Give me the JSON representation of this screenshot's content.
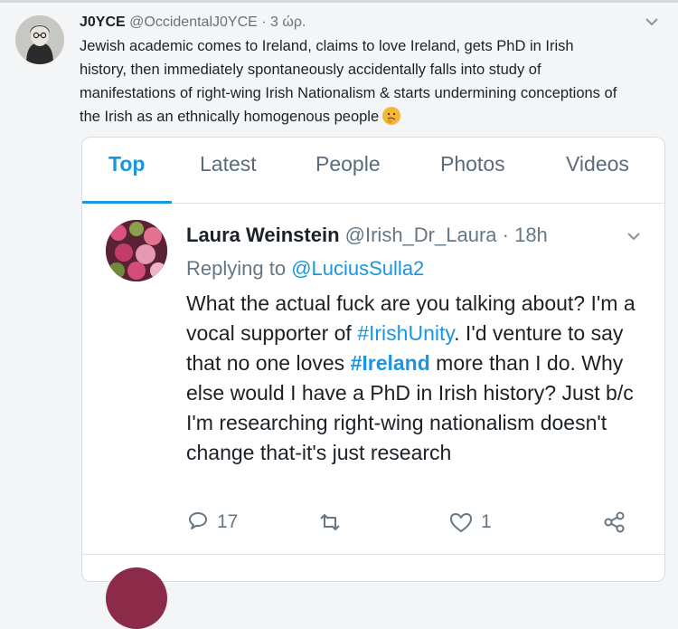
{
  "outer_tweet": {
    "name": "J0YCE",
    "handle": "@OccidentalJ0YCE",
    "time": "· 3 ώρ.",
    "text": "Jewish academic comes to Ireland, claims to love Ireland, gets PhD in Irish history, then immediately spontaneously accidentally falls into study of manifestations of right-wing Irish Nationalism & starts undermining conceptions of the Irish as an ethnically homogenous people",
    "emoji": "thinking-face-emoji"
  },
  "tabs": [
    {
      "label": "Top",
      "active": true
    },
    {
      "label": "Latest",
      "active": false
    },
    {
      "label": "People",
      "active": false
    },
    {
      "label": "Photos",
      "active": false
    },
    {
      "label": "Videos",
      "active": false
    }
  ],
  "quoted_tweet": {
    "name": "Laura Weinstein",
    "handle": "@Irish_Dr_Laura",
    "time": "· 18h",
    "replying_prefix": "Replying to",
    "replying_handle": "@LuciusSulla2",
    "text_parts": {
      "p1": "What the actual fuck are you talking about? I'm a vocal supporter of ",
      "tag1": "#IrishUnity",
      "p2": ". I'd venture to say that no one loves ",
      "tag2": "#Ireland",
      "p3": " more than I do. Why else would I have a PhD in Irish history? Just b/c I'm researching right-wing nationalism doesn't change that-it's just research"
    },
    "actions": {
      "replies": "17",
      "retweets": "",
      "likes": "1"
    }
  },
  "colors": {
    "accent": "#1b95e0",
    "muted": "#657786"
  }
}
